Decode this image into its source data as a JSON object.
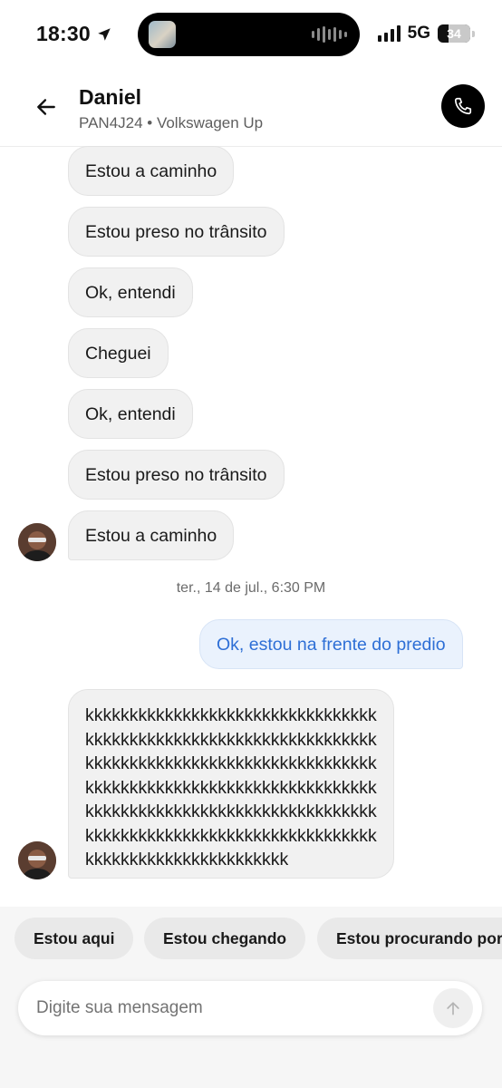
{
  "status_bar": {
    "time": "18:30",
    "network": "5G",
    "battery": "34",
    "battery_level_percent": 34
  },
  "header": {
    "driver_name": "Daniel",
    "vehicle_info": "PAN4J24 • Volkswagen Up",
    "icons": {
      "back": "arrow-left-icon",
      "call": "phone-icon"
    }
  },
  "messages_before": [
    {
      "text": "Estou a caminho"
    },
    {
      "text": "Estou preso no trânsito"
    },
    {
      "text": "Ok, entendi"
    },
    {
      "text": "Cheguei"
    },
    {
      "text": "Ok, entendi"
    },
    {
      "text": "Estou preso no trânsito"
    },
    {
      "text": "Estou a caminho"
    }
  ],
  "timestamp": "ter., 14 de jul., 6:30 PM",
  "outgoing_message": "Ok, estou na frente do predio",
  "long_message": "kkkkkkkkkkkkkkkkkkkkkkkkkkkkkkkkk\nkkkkkkkkkkkkkkkkkkkkkkkkkkkkkkkkk\nkkkkkkkkkkkkkkkkkkkkkkkkkkkkkkkkk\nkkkkkkkkkkkkkkkkkkkkkkkkkkkkkkkkk\nkkkkkkkkkkkkkkkkkkkkkkkkkkkkkkkkk\nkkkkkkkkkkkkkkkkkkkkkkkkkkkkkkkkk\nkkkkkkkkkkkkkkkkkkkkkkk",
  "quick_replies": [
    "Estou aqui",
    "Estou chegando",
    "Estou procurando por"
  ],
  "composer": {
    "placeholder": "Digite sua mensagem",
    "value": "",
    "send_icon": "arrow-up-icon"
  },
  "colors": {
    "incoming_bubble": "#f1f1f1",
    "outgoing_bubble": "#eaf2fd",
    "outgoing_text": "#2e6fd6",
    "call_button": "#000000"
  }
}
